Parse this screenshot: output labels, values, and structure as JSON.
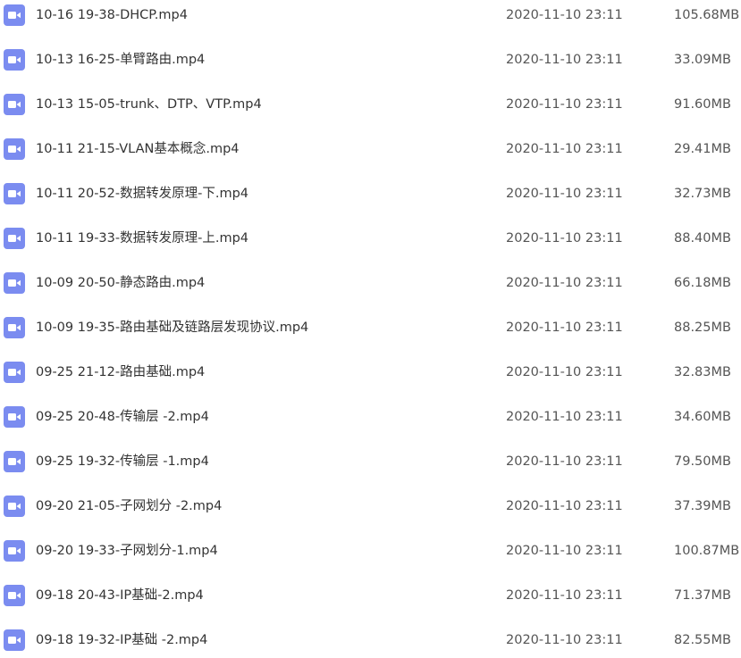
{
  "icon_color": "#7b8cf0",
  "file_icon": "video-file-icon",
  "files": [
    {
      "name": "10-16 19-38-DHCP.mp4",
      "modified": "2020-11-10 23:11",
      "size": "105.68MB"
    },
    {
      "name": "10-13 16-25-单臂路由.mp4",
      "modified": "2020-11-10 23:11",
      "size": "33.09MB"
    },
    {
      "name": "10-13 15-05-trunk、DTP、VTP.mp4",
      "modified": "2020-11-10 23:11",
      "size": "91.60MB"
    },
    {
      "name": "10-11 21-15-VLAN基本概念.mp4",
      "modified": "2020-11-10 23:11",
      "size": "29.41MB"
    },
    {
      "name": "10-11 20-52-数据转发原理-下.mp4",
      "modified": "2020-11-10 23:11",
      "size": "32.73MB"
    },
    {
      "name": "10-11 19-33-数据转发原理-上.mp4",
      "modified": "2020-11-10 23:11",
      "size": "88.40MB"
    },
    {
      "name": "10-09 20-50-静态路由.mp4",
      "modified": "2020-11-10 23:11",
      "size": "66.18MB"
    },
    {
      "name": "10-09 19-35-路由基础及链路层发现协议.mp4",
      "modified": "2020-11-10 23:11",
      "size": "88.25MB"
    },
    {
      "name": "09-25 21-12-路由基础.mp4",
      "modified": "2020-11-10 23:11",
      "size": "32.83MB"
    },
    {
      "name": "09-25 20-48-传输层 -2.mp4",
      "modified": "2020-11-10 23:11",
      "size": "34.60MB"
    },
    {
      "name": "09-25 19-32-传输层 -1.mp4",
      "modified": "2020-11-10 23:11",
      "size": "79.50MB"
    },
    {
      "name": "09-20 21-05-子网划分 -2.mp4",
      "modified": "2020-11-10 23:11",
      "size": "37.39MB"
    },
    {
      "name": "09-20 19-33-子网划分-1.mp4",
      "modified": "2020-11-10 23:11",
      "size": "100.87MB"
    },
    {
      "name": "09-18 20-43-IP基础-2.mp4",
      "modified": "2020-11-10 23:11",
      "size": "71.37MB"
    },
    {
      "name": "09-18 19-32-IP基础 -2.mp4",
      "modified": "2020-11-10 23:11",
      "size": "82.55MB"
    }
  ]
}
